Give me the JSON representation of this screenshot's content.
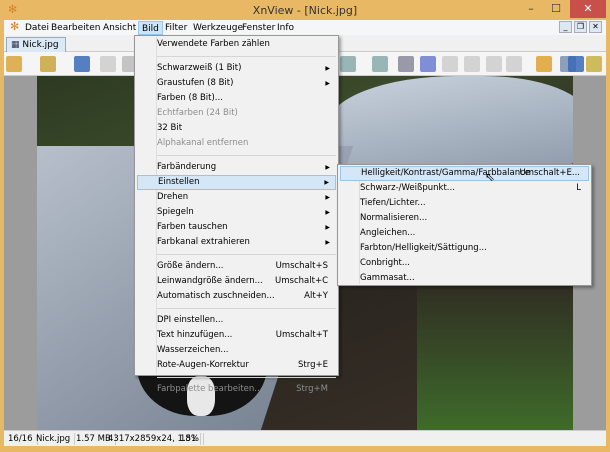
{
  "window": {
    "title": "XnView - [Nick.jpg]",
    "min": "–",
    "max": "☐",
    "close": "✕"
  },
  "menubar": [
    "Datei",
    "Bearbeiten",
    "Ansicht",
    "Bild",
    "Filter",
    "Werkzeuge",
    "Fenster",
    "Info"
  ],
  "tab": {
    "label": "Nick.jpg"
  },
  "bild_menu": [
    {
      "label": "Verwendete Farben zählen"
    },
    {
      "sep": true
    },
    {
      "label": "Schwarzweiß (1 Bit)",
      "sub": true
    },
    {
      "label": "Graustufen (8 Bit)",
      "sub": true
    },
    {
      "label": "Farben (8 Bit)..."
    },
    {
      "label": "Echtfarben (24 Bit)",
      "disabled": true
    },
    {
      "label": "32 Bit"
    },
    {
      "label": "Alphakanal entfernen",
      "disabled": true
    },
    {
      "sep": true
    },
    {
      "label": "Farbänderung",
      "sub": true
    },
    {
      "label": "Einstellen",
      "sub": true,
      "highlighted": true
    },
    {
      "label": "Drehen",
      "sub": true
    },
    {
      "label": "Spiegeln",
      "sub": true
    },
    {
      "label": "Farben tauschen",
      "sub": true
    },
    {
      "label": "Farbkanal extrahieren",
      "sub": true
    },
    {
      "sep": true
    },
    {
      "label": "Größe ändern...",
      "shortcut": "Umschalt+S"
    },
    {
      "label": "Leinwandgröße ändern...",
      "shortcut": "Umschalt+C"
    },
    {
      "label": "Automatisch zuschneiden...",
      "shortcut": "Alt+Y"
    },
    {
      "sep": true
    },
    {
      "label": "DPI einstellen..."
    },
    {
      "label": "Text hinzufügen...",
      "shortcut": "Umschalt+T"
    },
    {
      "label": "Wasserzeichen..."
    },
    {
      "label": "Rote-Augen-Korrektur",
      "shortcut": "Strg+E"
    },
    {
      "sep": true
    },
    {
      "label": "Farbpalette bearbeiten...",
      "shortcut": "Strg+M",
      "disabled": true
    }
  ],
  "einstellen_menu": [
    {
      "label": "Helligkeit/Kontrast/Gamma/Farbbalance",
      "shortcut": "Umschalt+E...",
      "highlighted": true
    },
    {
      "label": "Schwarz-/Weißpunkt...",
      "shortcut": "L"
    },
    {
      "label": "Tiefen/Lichter..."
    },
    {
      "label": "Normalisieren..."
    },
    {
      "label": "Angleichen..."
    },
    {
      "label": "Farbton/Helligkeit/Sättigung..."
    },
    {
      "label": "Conbright..."
    },
    {
      "label": "Gammasat..."
    }
  ],
  "status": [
    "16/16",
    "Nick.jpg",
    "1.57 MB",
    "4317x2859x24, 1.51",
    "18%"
  ],
  "colors": {
    "frame": "#e9b865",
    "close": "#c7504b",
    "highlight": "#d5e6f7"
  }
}
